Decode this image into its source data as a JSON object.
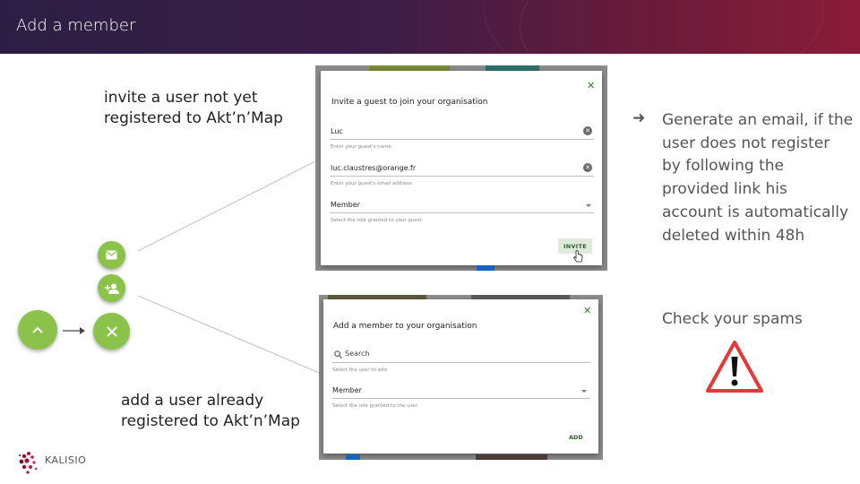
{
  "header": {
    "title": "Add a member"
  },
  "captions": {
    "invite": [
      "invite a user not yet",
      "registered to Akt’n’Map"
    ],
    "add": [
      "add a user already",
      "registered to Akt’n’Map"
    ]
  },
  "fabs": {
    "mail_icon": "mail-icon",
    "person_add_icon": "person-add-icon",
    "expand_icon": "chevron-up-icon",
    "close_icon": "close-icon"
  },
  "invite_dialog": {
    "title": "Invite a guest to join your organisation",
    "close": "✕",
    "name_value": "Luc",
    "name_hint": "Enter your guest's name",
    "email_value": "luc.claustres@orange.fr",
    "email_hint": "Enter your guest's email address",
    "role_value": "Member",
    "role_hint": "Select the role granted to your guest",
    "invite_label": "INVITE"
  },
  "add_dialog": {
    "title": "Add a member to your organisation",
    "close": "✕",
    "search_placeholder": "Search",
    "search_hint": "Select the user to add",
    "role_value": "Member",
    "role_hint": "Select the role granted to the user",
    "add_label": "ADD"
  },
  "notes": {
    "arrow": "➜",
    "lines": [
      "Generate an email, if the",
      "user does not register",
      "by following the",
      "provided link his",
      "account is automatically",
      "deleted within 48h"
    ],
    "spams": "Check your spams"
  },
  "logo": {
    "text": "KALISIO"
  },
  "colors": {
    "fab_green": "#8bc34a",
    "warning_red": "#e53935",
    "header_start": "#2b1e44",
    "header_end": "#8a1c3a"
  }
}
